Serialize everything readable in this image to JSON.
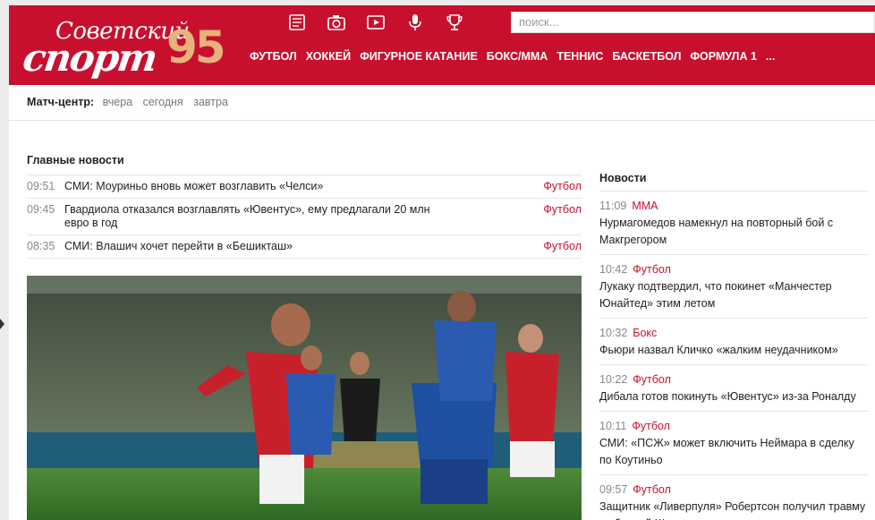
{
  "logo": {
    "line1": "Советский",
    "line2": "спорт",
    "badge": "95"
  },
  "header_icons": [
    "news-icon",
    "photo-icon",
    "video-icon",
    "microphone-icon",
    "trophy-icon"
  ],
  "search": {
    "placeholder": "поиск..."
  },
  "nav": [
    "ФУТБОЛ",
    "ХОККЕЙ",
    "ФИГУРНОЕ КАТАНИЕ",
    "БОКС/ММА",
    "ТЕННИС",
    "БАСКЕТБОЛ",
    "ФОРМУЛА 1",
    "..."
  ],
  "match_center": {
    "label": "Матч-центр:",
    "days": [
      "вчера",
      "сегодня",
      "завтра"
    ]
  },
  "main_news": {
    "title": "Главные новости",
    "items": [
      {
        "time": "09:51",
        "headline": "СМИ: Моуриньо вновь может возглавить «Челси»",
        "category": "Футбол"
      },
      {
        "time": "09:45",
        "headline": "Гвардиола отказался возглавлять «Ювентус», ему предлагали 20 млн евро в год",
        "category": "Футбол"
      },
      {
        "time": "08:35",
        "headline": "СМИ: Влашич хочет перейти в «Бешикташ»",
        "category": "Футбол"
      }
    ]
  },
  "side_news": {
    "title": "Новости",
    "items": [
      {
        "time": "11:09",
        "category": "ММА",
        "headline": "Нурмагомедов намекнул на повторный бой с Макгрегором"
      },
      {
        "time": "10:42",
        "category": "Футбол",
        "headline": "Лукаку подтвердил, что покинет «Манчестер Юнайтед» этим летом"
      },
      {
        "time": "10:32",
        "category": "Бокс",
        "headline": "Фьюри назвал Кличко «жалким неудачником»"
      },
      {
        "time": "10:22",
        "category": "Футбол",
        "headline": "Дибала готов покинуть «Ювентус» из-за Роналду"
      },
      {
        "time": "10:11",
        "category": "Футбол",
        "headline": "СМИ: «ПСЖ» может включить Неймара в сделку по Коутиньо"
      },
      {
        "time": "09:57",
        "category": "Футбол",
        "headline": "Защитник «Ливерпуля» Робертсон получил травму в сборной Шотландии"
      }
    ]
  },
  "colors": {
    "brand_red": "#c8102e",
    "logo_gold": "#e7b37c",
    "muted": "#888888"
  }
}
